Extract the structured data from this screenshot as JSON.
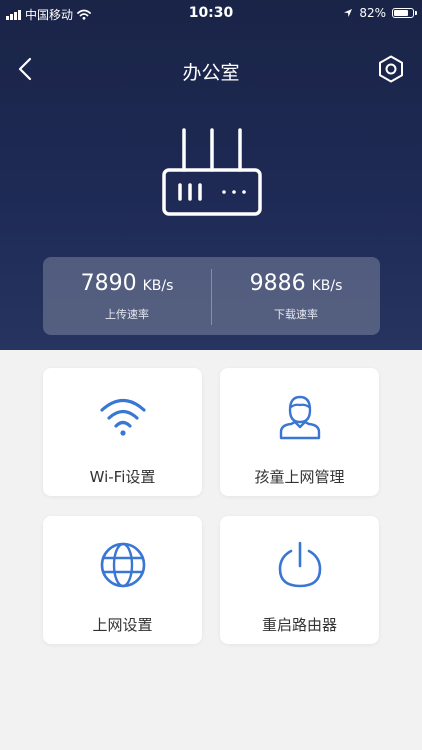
{
  "status_bar": {
    "carrier": "中国移动",
    "time": "10:30",
    "battery_percent": "82%",
    "battery_level": 0.82
  },
  "nav": {
    "title": "办公室",
    "back_icon": "chevron-left-icon",
    "settings_icon": "hexagon-settings-icon"
  },
  "speed": {
    "upload": {
      "value": "7890",
      "unit": "KB/s",
      "label": "上传速率"
    },
    "download": {
      "value": "9886",
      "unit": "KB/s",
      "label": "下载速率"
    }
  },
  "accent_color": "#3a76d4",
  "menu": [
    {
      "label": "Wi-Fi设置",
      "icon": "wifi-icon"
    },
    {
      "label": "孩童上网管理",
      "icon": "child-user-icon"
    },
    {
      "label": "上网设置",
      "icon": "globe-icon"
    },
    {
      "label": "重启路由器",
      "icon": "power-icon"
    }
  ]
}
